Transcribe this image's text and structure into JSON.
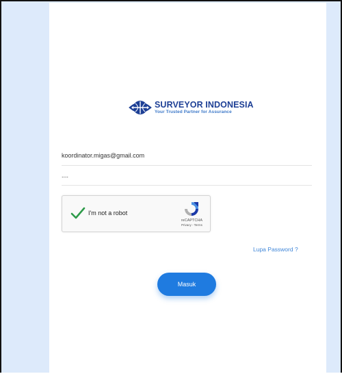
{
  "brand": {
    "name": "SURVEYOR INDONESIA",
    "tagline": "Your Trusted Partner for Assurance",
    "logo_icon": "globe-logo-icon"
  },
  "form": {
    "email_value": "koordinator.migas@gmail.com",
    "password_value": "....",
    "captcha": {
      "label": "I'm not a robot",
      "brand": "reCAPTCHA",
      "links": "Privacy - Terms",
      "checked": true
    },
    "forgot_label": "Lupa Password ?",
    "submit_label": "Masuk"
  },
  "colors": {
    "page_bg": "#ddeafb",
    "primary": "#1f7be0",
    "link": "#3f86d8",
    "brand_navy": "#1d3f95",
    "check_green": "#2e9b4a"
  }
}
